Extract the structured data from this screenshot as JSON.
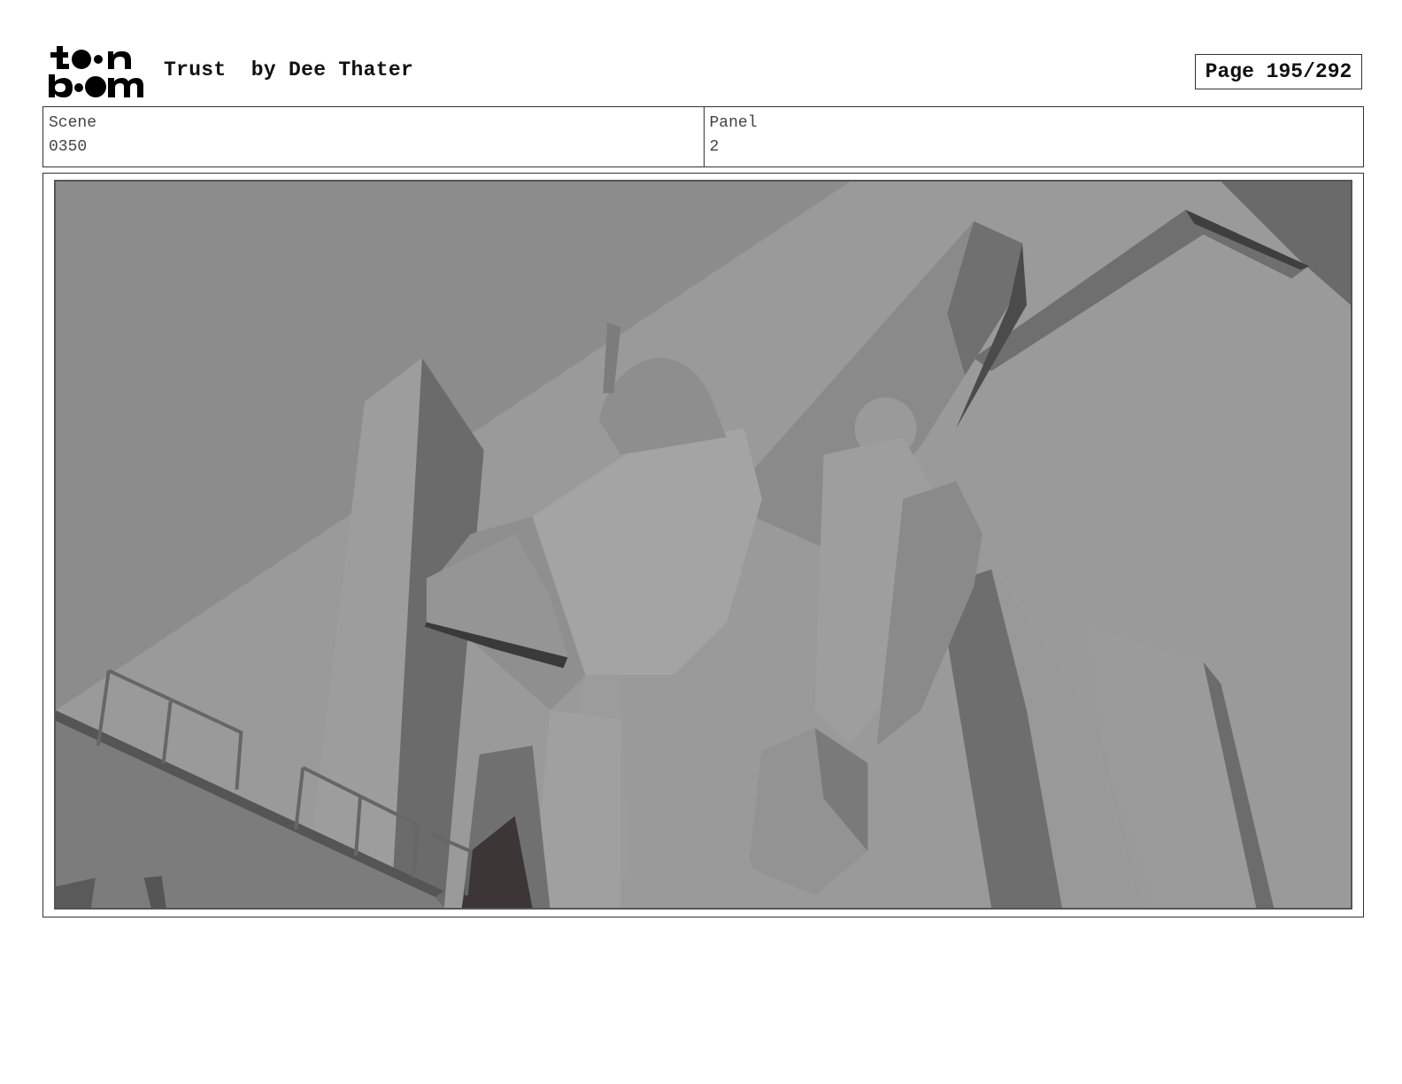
{
  "header": {
    "logo_text": "toon boom",
    "title": "Trust  by Dee Thater",
    "page": "Page 195/292"
  },
  "info": {
    "scene_label": "Scene",
    "scene_value": "0350",
    "panel_label": "Panel",
    "panel_value": "2"
  },
  "panel": {
    "image_description_icon": "storyboard-panel-image"
  }
}
